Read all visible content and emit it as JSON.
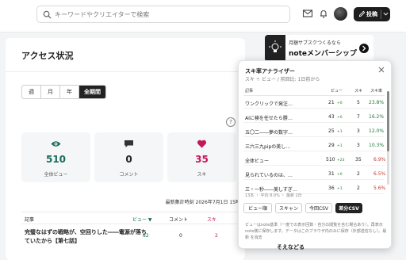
{
  "header": {
    "search_placeholder": "キーワードやクリエイターで検索",
    "post_label": "投稿"
  },
  "access": {
    "title": "アクセス状況",
    "periods": [
      "週",
      "月",
      "年",
      "全期間"
    ],
    "active_period": "全期間",
    "help": "?",
    "stats": [
      {
        "value": "510",
        "label": "全体ビュー",
        "color": "#1a6b5e"
      },
      {
        "value": "0",
        "label": "コメント",
        "color": "#222222"
      },
      {
        "value": "35",
        "label": "スキ",
        "color": "#c2185b"
      }
    ],
    "updated": "最新集計時刻 2026年7月1日 15時",
    "table": {
      "headers": {
        "article": "記事",
        "views": "ビュー",
        "comments": "コメント",
        "likes": "スキ"
      },
      "row": {
        "title": "完璧なはずの戦略が、空回りした――電源が落ちていたから【第七話】",
        "views": "82",
        "comments": "0",
        "likes": "2"
      }
    }
  },
  "banner": {
    "sub": "月額サブスクつくるなら",
    "main": "noteメンバーシップ"
  },
  "analyzer": {
    "title": "スキ率アナライザー",
    "subtitle": "スキ ÷ ビュー / 前回比: 1日前から",
    "headers": {
      "article": "記事",
      "views": "ビュー",
      "likes": "スキ",
      "rate": "スキ率"
    },
    "rows": [
      {
        "title": "ワンクリックで発注…",
        "views": "21",
        "vdelta": "+0",
        "likes": "5",
        "ldelta": "",
        "rate": "23.8%",
        "rate_color": "#1f7a3a"
      },
      {
        "title": "AIに検を任せたら勝…",
        "views": "43",
        "vdelta": "+0",
        "likes": "7",
        "ldelta": "",
        "rate": "16.2%",
        "rate_color": "#1f7a3a"
      },
      {
        "title": "五〇二――夢の数字…",
        "views": "25",
        "vdelta": "+1",
        "likes": "3",
        "ldelta": "",
        "rate": "12.0%",
        "rate_color": "#1f7a3a"
      },
      {
        "title": "三六三九pipの美し…",
        "views": "29",
        "vdelta": "+1",
        "likes": "3",
        "ldelta": "",
        "rate": "10.3%",
        "rate_color": "#1f7a3a"
      },
      {
        "title": "全体ビュー",
        "views": "510",
        "vdelta": "+23",
        "likes": "35",
        "ldelta": "",
        "rate": "6.9%",
        "rate_color": "#c0392b"
      },
      {
        "title": "見られているのは、…",
        "views": "31",
        "vdelta": "+0",
        "likes": "2",
        "ldelta": "",
        "rate": "6.5%",
        "rate_color": "#c0392b"
      },
      {
        "title": "三・一秒――美しすぎ…",
        "views": "36",
        "vdelta": "+1",
        "likes": "2",
        "ldelta": "",
        "rate": "5.6%",
        "rate_color": "#c0392b"
      }
    ],
    "summary": "13本 ・ 平均 8.0% ・ 最新 2日",
    "buttons": [
      "ビュー順",
      "スキャン",
      "今回CSV",
      "差分CSV"
    ],
    "footnote": "ビューはnote基準（一度での表示回数・自分の閲覧を含む場合あり）。再表示 note側に保存します。データはこのブラウザ内のみに保存（外部送信なし）。最新 を消去",
    "remove_label": "そえなどる"
  }
}
